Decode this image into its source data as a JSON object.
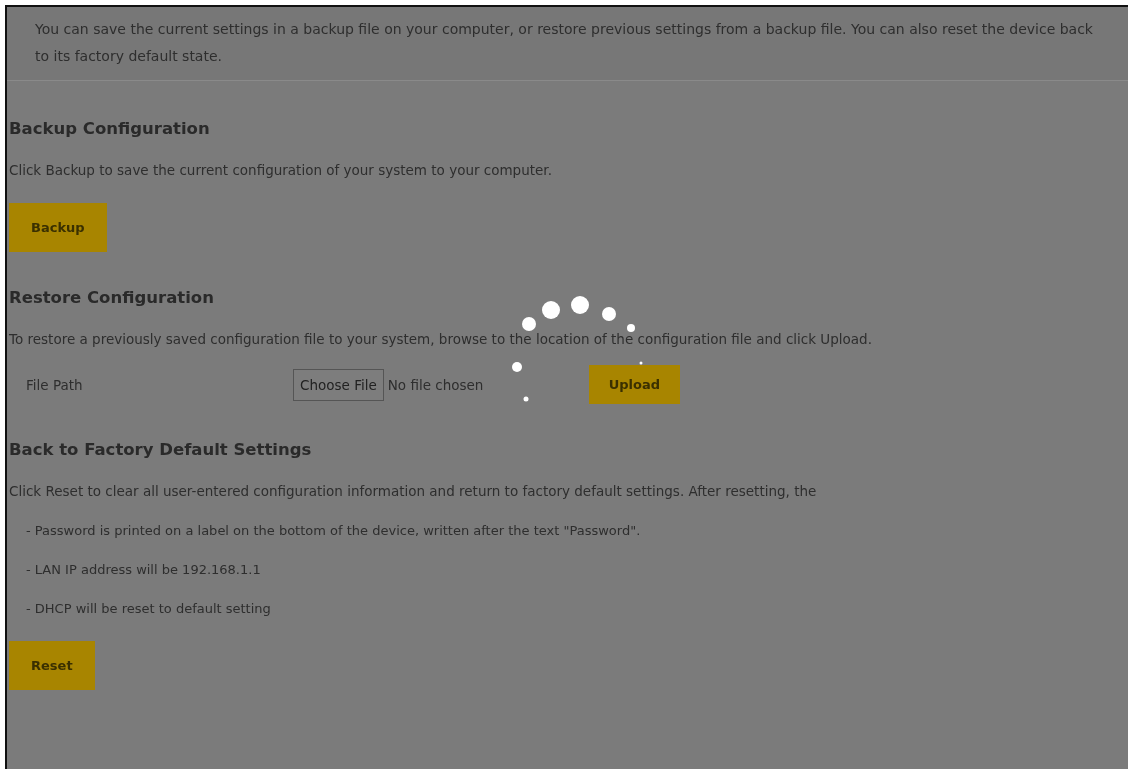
{
  "intro": "You can save the current settings in a backup file on your computer, or restore previous settings from a backup file. You can also reset the device back to its factory default state.",
  "sections": [
    {
      "kind": "backup",
      "title": "Backup Configuration",
      "description": "Click Backup to save the current configuration of your system to your computer.",
      "button": "Backup"
    },
    {
      "kind": "restore",
      "title": "Restore Configuration",
      "description": "To restore a previously saved configuration file to your system, browse to the location of the configuration file and click Upload.",
      "field_label": "File Path",
      "file_button": "Choose File",
      "file_status": "No file chosen",
      "button": "Upload"
    },
    {
      "kind": "reset",
      "title": "Back to Factory Default Settings",
      "description": "Click Reset to clear all user-entered configuration information and return to factory default settings. After resetting, the",
      "notes": [
        "- Password is printed on a label on the bottom of the device, written after the text \"Password\".",
        "- LAN IP address will be 192.168.1.1",
        "- DHCP will be reset to default setting"
      ],
      "button": "Reset"
    }
  ]
}
